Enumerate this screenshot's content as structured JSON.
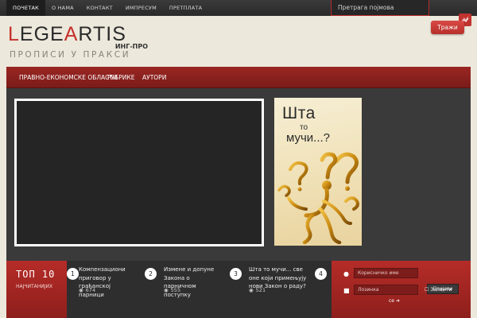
{
  "topnav": {
    "items": [
      "ПОЧЕТАК",
      "О НАМА",
      "КОНТАКТ",
      "ИМПРЕСУМ",
      "ПРЕТПЛАТА"
    ]
  },
  "search": {
    "placeholder": "Претрага појмова",
    "button": "Тражи"
  },
  "logo": {
    "first_letter": "L",
    "first_rest": "EGE",
    "second_letter": "A",
    "second_rest": "RTIS",
    "tagline": "ИНГ-ПРО",
    "subtitle": "ПРОПИСИ У ПРАКСИ"
  },
  "mainnav": {
    "items": [
      "ПРАВНО-ЕКОНОМСКЕ ОБЛАСТИ",
      "РУБРИКЕ",
      "АУТОРИ"
    ]
  },
  "ad": {
    "line1": "Шта",
    "line2": "то",
    "line3": "мучи...?"
  },
  "top10": {
    "title": "ТОП 10",
    "subtitle": "НАЈЧИТАНИЈИХ"
  },
  "articles": [
    {
      "num": "1",
      "title": "Компензациони приговор у грађанској парници",
      "views": "674"
    },
    {
      "num": "2",
      "title": "Измене и допуне Закона о парничном поступку",
      "views": "555"
    },
    {
      "num": "3",
      "title": "Шта то мучи... све оне који примењују нови Закон о раду?",
      "views": "521"
    },
    {
      "num": "4",
      "title": "",
      "views": ""
    }
  ],
  "login": {
    "username_placeholder": "Корисничко име",
    "password_placeholder": "Лозинка",
    "button": "Пријави",
    "remember": "Запамти",
    "forgot": "се"
  },
  "colors": {
    "accent": "#b52c28",
    "dark": "#3b3a3b",
    "background": "#ece8dc"
  }
}
